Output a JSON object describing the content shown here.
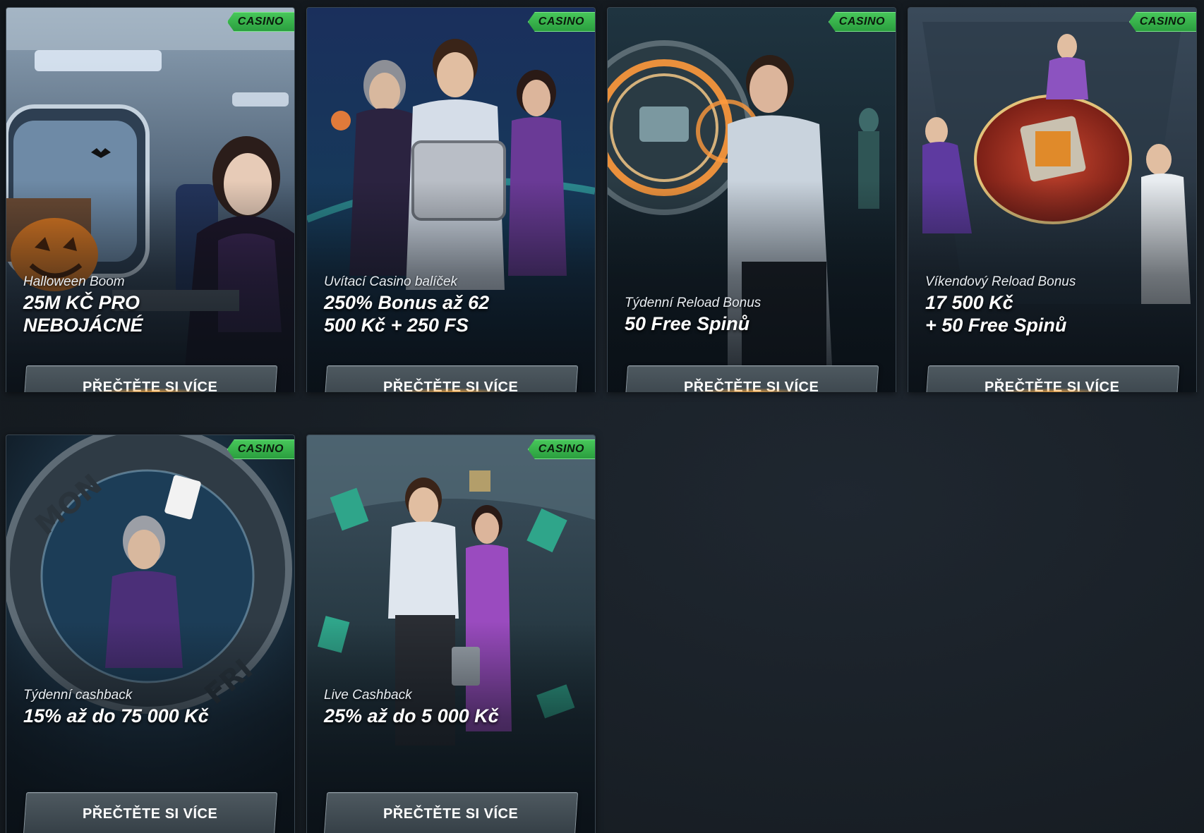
{
  "badge_label": "CASINO",
  "cta_label": "PŘEČTĚTE SI VÍCE",
  "colors": {
    "badge_green": "#3fbf55",
    "background": "#161c22",
    "button_gray": "#424c53"
  },
  "cards": [
    {
      "subtitle": "Halloween Boom",
      "headline_1": "25M KČ PRO",
      "headline_2": "NEBOJÁCNÉ"
    },
    {
      "subtitle": "Uvítací Casino balíček",
      "headline_1": "250% Bonus až 62",
      "headline_2": "500 Kč + 250 FS"
    },
    {
      "subtitle": "Týdenní Reload Bonus",
      "headline_1": "50 Free Spinů",
      "headline_2": ""
    },
    {
      "subtitle": "Víkendový Reload Bonus",
      "headline_1": "17 500 Kč",
      "headline_2": "+ 50 Free Spinů"
    },
    {
      "subtitle": "Týdenní cashback",
      "headline_1": "15% až do 75 000 Kč",
      "headline_2": ""
    },
    {
      "subtitle": "Live Cashback",
      "headline_1": "25% až do 5 000 Kč",
      "headline_2": ""
    }
  ]
}
